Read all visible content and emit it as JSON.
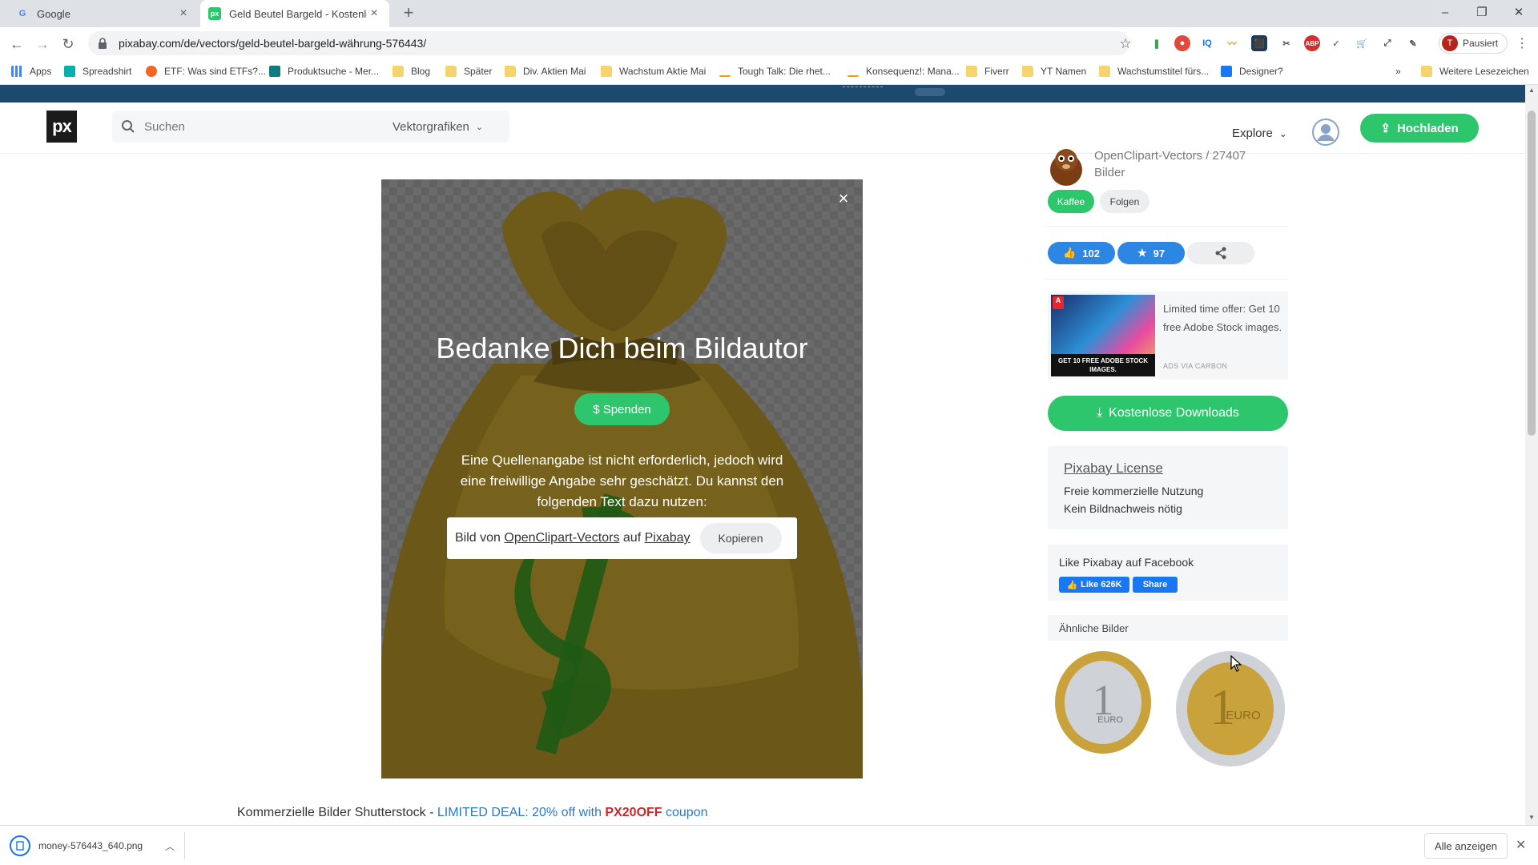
{
  "browser": {
    "tabs": [
      {
        "title": "Google",
        "favicon": "G"
      },
      {
        "title": "Geld Beutel Bargeld - Kostenlose",
        "favicon": "px"
      }
    ],
    "new_tab": "+",
    "url": "pixabay.com/de/vectors/geld-beutel-bargeld-währung-576443/",
    "profile_initial": "T",
    "profile_label": "Pausiert",
    "bookmarks": [
      "Apps",
      "Spreadshirt",
      "ETF: Was sind ETFs?...",
      "Produktsuche - Mer...",
      "Blog",
      "Später",
      "Div. Aktien Mai",
      "Wachstum Aktie Mai",
      "Tough Talk: Die rhet...",
      "Konsequenz!: Mana...",
      "Fiverr",
      "YT Namen",
      "Wachstumstitel fürs...",
      "Designer?"
    ],
    "bookmarks_more": "»",
    "other_bookmarks": "Weitere Lesezeichen"
  },
  "header": {
    "logo": "px",
    "search_placeholder": "Suchen",
    "search_category": "Vektorgrafiken",
    "explore": "Explore",
    "upload": "Hochladen"
  },
  "modal": {
    "close": "×",
    "title": "Bedanke Dich beim Bildautor",
    "donate": "$ Spenden",
    "text": "Eine Quellenangabe ist nicht erforderlich, jedoch wird eine freiwillige Angabe sehr geschätzt. Du kannst den folgenden Text dazu nutzen:",
    "attrib_prefix": "Bild von",
    "attrib_author": "OpenClipart-Vectors",
    "attrib_mid": "auf",
    "attrib_site": "Pixabay",
    "copy": "Kopieren"
  },
  "promo": {
    "prefix": "Kommerzielle Bilder Shutterstock - ",
    "deal": "LIMITED DEAL: 20% off with ",
    "code": "PX20OFF",
    "suffix": " coupon"
  },
  "sidebar": {
    "author_line": "OpenClipart-Vectors / 27407 Bilder",
    "kaffee": "Kaffee",
    "folgen": "Folgen",
    "likes": "102",
    "favorites": "97",
    "ad_text": "Limited time offer: Get 10 free Adobe Stock images.",
    "ad_caption": "GET 10 FREE ADOBE STOCK IMAGES.",
    "ad_via": "ADS VIA CARBON",
    "download": "Kostenlose Downloads",
    "license_title": "Pixabay License",
    "license_line1": "Freie kommerzielle Nutzung",
    "license_line2": "Kein Bildnachweis nötig",
    "fb_title": "Like Pixabay auf Facebook",
    "fb_like": "Like 626K",
    "fb_share": "Share",
    "similar_title": "Ähnliche Bilder",
    "coin_text": "EURO"
  },
  "download_shelf": {
    "filename": "money-576443_640.png",
    "show_all": "Alle anzeigen"
  },
  "colors": {
    "accent_green": "#2ec66d",
    "like_blue": "#2b87e3",
    "deal_blue": "#2b78c5",
    "coupon_red": "#c8282d",
    "topbar_navy": "#1c4a6e"
  }
}
